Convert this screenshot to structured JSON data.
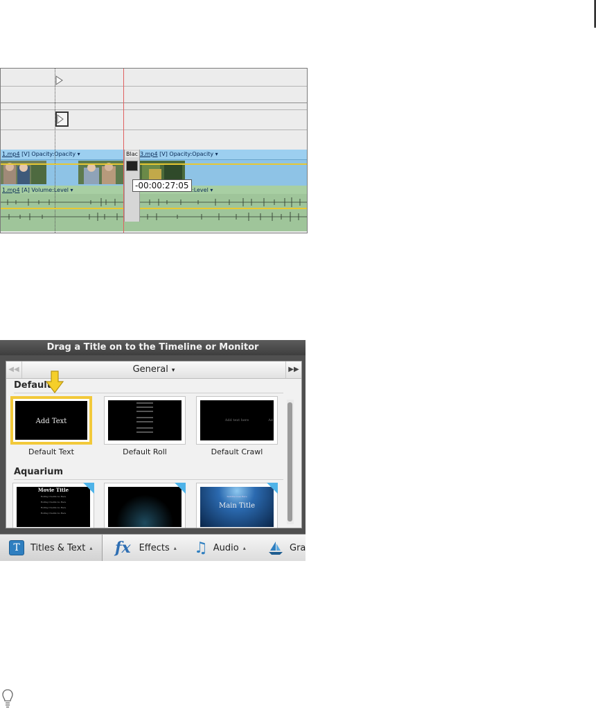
{
  "timeline": {
    "video_clip_1_file": "1.mp4",
    "video_clip_1_rest": " [V] Opacity:Opacity ▾",
    "black_clip_label": "Blac",
    "video_clip_3_file": "3.mp4",
    "video_clip_3_rest": " [V] Opacity:Opacity ▾",
    "audio_clip_1_file": "1.mp4",
    "audio_clip_1_rest": " [A] Volume:Level ▾",
    "audio_clip_3_rest": "ne:Level ▾",
    "timecode": "-00:00:27:05"
  },
  "titles_panel": {
    "header": "Drag a Title on to the Timeline or Monitor",
    "nav_prev": "◀◀",
    "nav_next": "▶▶",
    "category": "General",
    "category_caret": "▾",
    "sections": [
      {
        "name": "Default",
        "tiles": [
          {
            "caption": "Default Text",
            "preview_text": "Add Text"
          },
          {
            "caption": "Default Roll",
            "preview_text": ""
          },
          {
            "caption": "Default Crawl",
            "preview_text": "Add text here"
          }
        ]
      },
      {
        "name": "Aquarium",
        "tiles": [
          {
            "caption": "",
            "preview_text": "Movie Title"
          },
          {
            "caption": "",
            "preview_text": ""
          },
          {
            "caption": "",
            "preview_text": "Main Title"
          }
        ]
      }
    ],
    "crawl_extra": "Ad",
    "aquarium_subtitle": "Subtitle Goes Here",
    "roll_line_text": "Rolling Credits Go Here",
    "arrow_icon": "down-arrow-icon",
    "arrow_color": "#f5cf2a"
  },
  "bottom_bar": {
    "tabs": [
      {
        "label": "Titles & Text",
        "icon": "T",
        "active": true
      },
      {
        "label": "Effects",
        "icon": "fx",
        "active": false
      },
      {
        "label": "Audio",
        "icon": "♫",
        "active": false
      },
      {
        "label": "Gra",
        "icon": "boat",
        "active": false
      }
    ],
    "tab_caret": "▴"
  },
  "colors": {
    "selected_tile_border": "#f2c93a",
    "video_track": "#8ec3e6",
    "audio_track": "#9fc59a",
    "playhead": "#e06060"
  }
}
